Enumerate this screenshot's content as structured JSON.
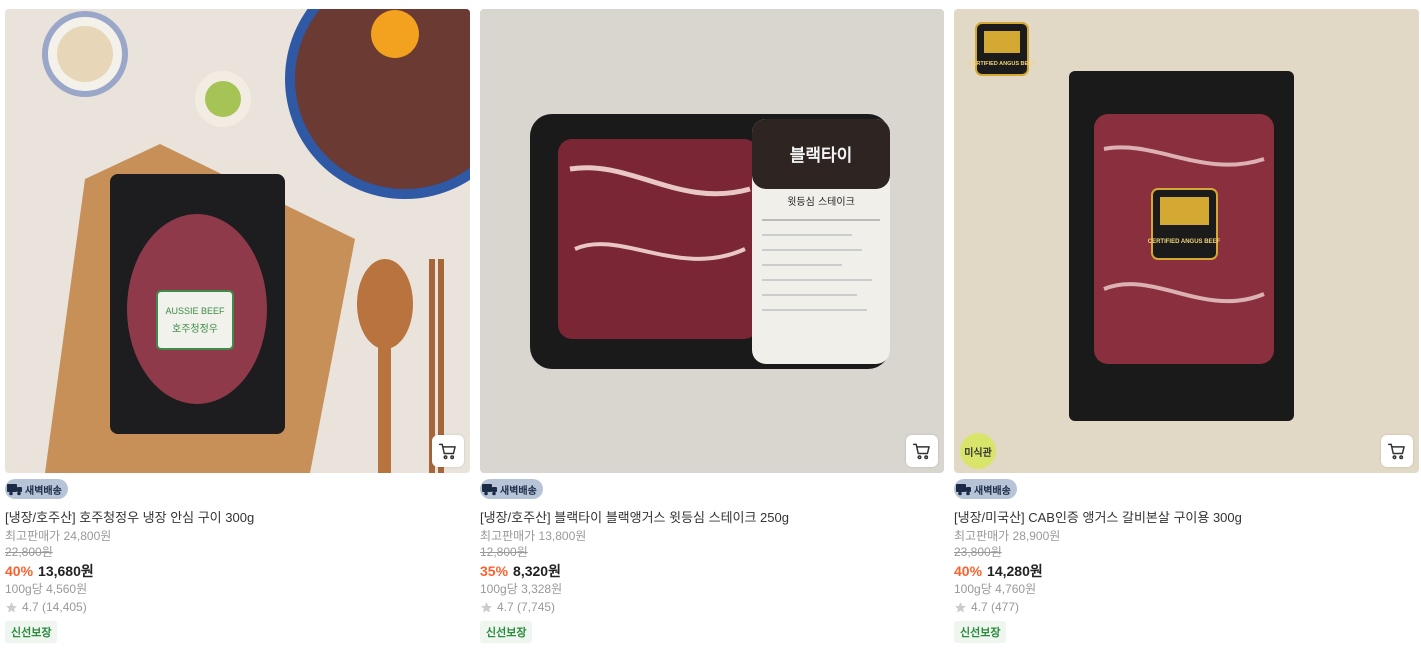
{
  "products": [
    {
      "name": "[냉장/호주산] 호주청정우 냉장 안심 구이 300g",
      "max_price": "최고판매가 24,800원",
      "original_price": "22,800원",
      "discount": "40%",
      "price": "13,680원",
      "unit_price": "100g당 4,560원",
      "rating": "4.7 (14,405)",
      "delivery_label": "새벽배송",
      "fresh_label": "신선보장",
      "package_label": "AUSSIE BEEF",
      "package_sub": "호주청정우"
    },
    {
      "name": "[냉장/호주산] 블랙타이 블랙앵거스 윗등심 스테이크 250g",
      "max_price": "최고판매가 13,800원",
      "original_price": "12,800원",
      "discount": "35%",
      "price": "8,320원",
      "unit_price": "100g당 3,328원",
      "rating": "4.7 (7,745)",
      "delivery_label": "새벽배송",
      "fresh_label": "신선보장",
      "package_label": "블랙타이",
      "package_sub": "윗등심 스테이크"
    },
    {
      "name": "[냉장/미국산] CAB인증 앵거스 갈비본살 구이용 300g",
      "max_price": "최고판매가 28,900원",
      "original_price": "23,800원",
      "discount": "40%",
      "price": "14,280원",
      "unit_price": "100g당 4,760원",
      "rating": "4.7 (477)",
      "delivery_label": "새벽배송",
      "fresh_label": "신선보장",
      "round_badge": "미식관",
      "package_label": "CERTIFIED ANGUS BEEF",
      "logo_text": "CERTIFIED ANGUS BEEF"
    }
  ],
  "icons": {
    "cart": "cart-icon",
    "star": "star-icon",
    "truck": "truck-icon"
  },
  "colors": {
    "discount": "#fa622f",
    "delivery_badge": "#b7c4d8",
    "fresh_badge_text": "#2b8a3e",
    "round_badge": "#d9e56a"
  }
}
